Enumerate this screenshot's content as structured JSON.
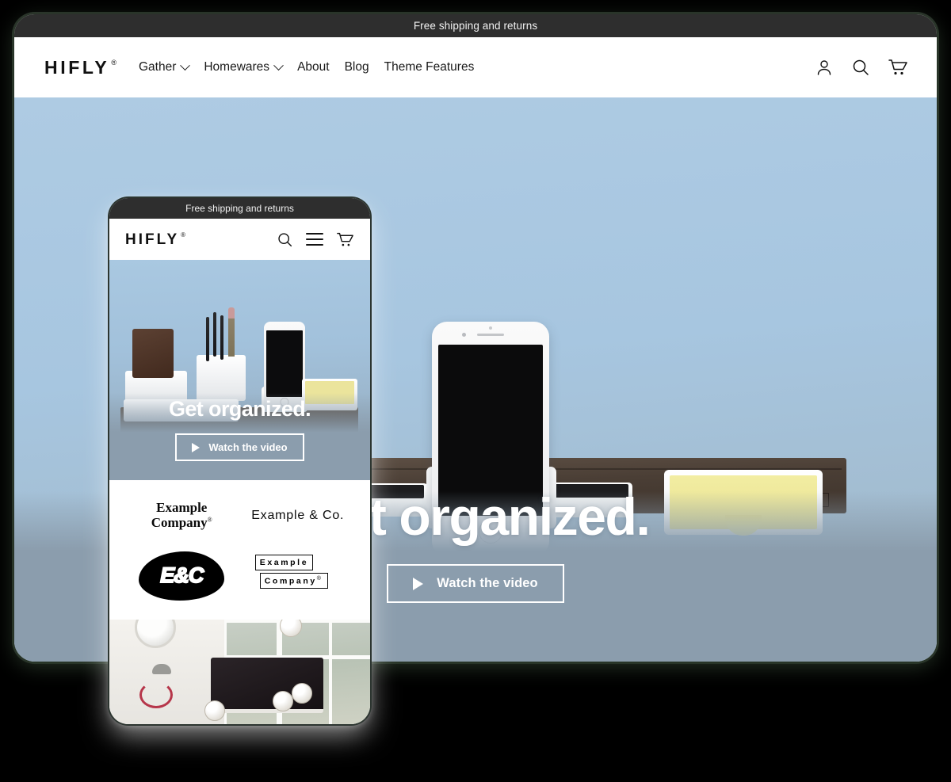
{
  "announcement": "Free shipping and returns",
  "brand": {
    "name": "HIFLY",
    "trademark": "®"
  },
  "nav": {
    "items": [
      {
        "label": "Gather",
        "has_dropdown": true
      },
      {
        "label": "Homewares",
        "has_dropdown": true
      },
      {
        "label": "About",
        "has_dropdown": false
      },
      {
        "label": "Blog",
        "has_dropdown": false
      },
      {
        "label": "Theme Features",
        "has_dropdown": false
      }
    ]
  },
  "header_icons": [
    {
      "name": "account-icon",
      "label": "Account"
    },
    {
      "name": "search-icon",
      "label": "Search"
    },
    {
      "name": "cart-icon",
      "label": "Cart"
    }
  ],
  "hero": {
    "title": "Get organized.",
    "cta_label": "Watch the video",
    "play_icon": "play-icon",
    "background_color": "#a7c6e0",
    "overlay_color": "#8b9dad"
  },
  "mobile": {
    "announcement": "Free shipping and returns",
    "brand": {
      "name": "HIFLY",
      "trademark": "®"
    },
    "icons": [
      {
        "name": "search-icon",
        "label": "Search"
      },
      {
        "name": "menu-icon",
        "label": "Menu"
      },
      {
        "name": "cart-icon",
        "label": "Cart"
      }
    ],
    "hero": {
      "title": "Get organized.",
      "cta_label": "Watch the video"
    },
    "logos": [
      {
        "style": "serif",
        "line1": "Example",
        "line2": "Company",
        "trademark": "®"
      },
      {
        "style": "sans",
        "text": "Example & Co."
      },
      {
        "style": "blob",
        "text": "E&C"
      },
      {
        "style": "boxed",
        "line1": "Example",
        "line2": "Company",
        "trademark": "®"
      }
    ]
  },
  "theme": {
    "announcement_bg": "#2e2e2e",
    "page_bg": "#000000",
    "frame_border": "#2c3530",
    "text_dark": "#111111",
    "text_light": "#ffffff",
    "note_yellow": "#ebe49c",
    "wood_brown": "#4a3e35"
  }
}
